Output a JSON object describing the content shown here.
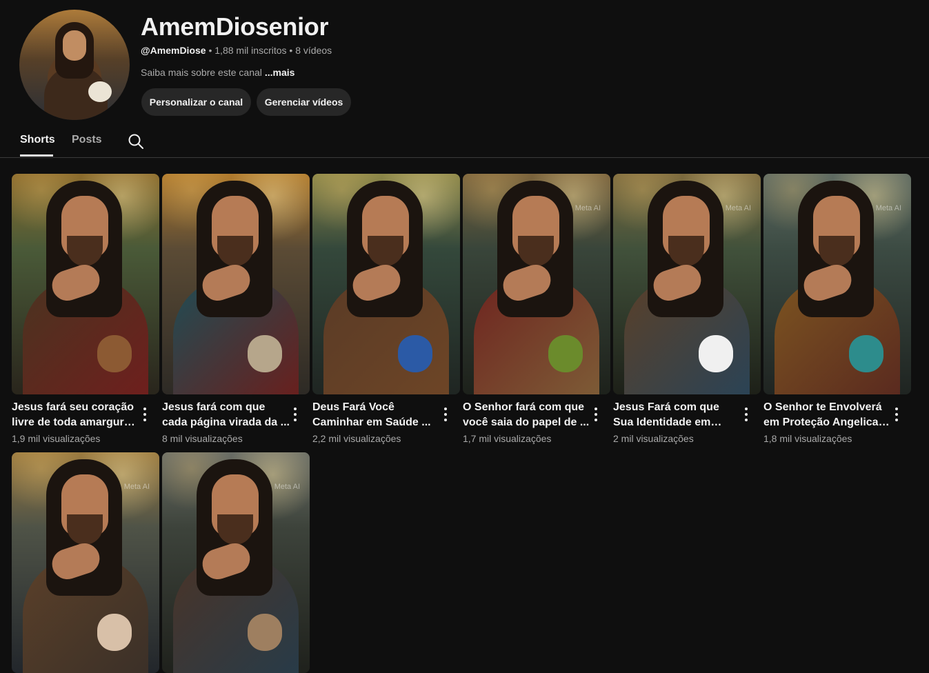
{
  "channel": {
    "name": "AmemDiosenior",
    "handle": "@AmemDiose",
    "subscribers": "1,88 mil inscritos",
    "videos_count": "8 vídeos",
    "about": "Saiba mais sobre este canal",
    "more_label": "...mais"
  },
  "buttons": {
    "customize": "Personalizar o canal",
    "manage": "Gerenciar vídeos"
  },
  "tabs": [
    {
      "label": "Shorts"
    },
    {
      "label": "Posts"
    }
  ],
  "cards": [
    {
      "title": "Jesus fará seu coração livre de toda amargura ...",
      "views": "1,9 mil visualizações",
      "colors": {
        "sky1": "#8c6b2c",
        "sky2": "#4a5a38",
        "ground": "#29251c",
        "robe1": "#4a3420",
        "robe2": "#6e1f1d",
        "animal": "#8c5a33"
      }
    },
    {
      "title": "Jesus fará com que cada página virada da ...",
      "views": "8 mil visualizações",
      "colors": {
        "sky1": "#b17b2d",
        "sky2": "#5b4b35",
        "ground": "#2d2a25",
        "robe1": "#1f4d55",
        "robe2": "#68201e",
        "animal": "#b6a68b"
      }
    },
    {
      "title": "Deus Fará Você Caminhar em Saúde ...",
      "views": "2,2 mil visualizações",
      "colors": {
        "sky1": "#8d8748",
        "sky2": "#34483b",
        "ground": "#1f2522",
        "robe1": "#5a3b26",
        "robe2": "#6d4526",
        "animal": "#2b5aa6"
      }
    },
    {
      "title": "O Senhor fará com que você saia do papel de ...",
      "views": "1,7 mil visualizações",
      "colors": {
        "sky1": "#7b633c",
        "sky2": "#39453a",
        "ground": "#1d211b",
        "robe1": "#6e241f",
        "robe2": "#7d5b36",
        "animal": "#6b8b2c"
      }
    },
    {
      "title": "Jesus Fará com que Sua Identidade em Cristo ...",
      "views": "2 mil visualizações",
      "colors": {
        "sky1": "#7e6b3e",
        "sky2": "#41513b",
        "ground": "#1d2018",
        "robe1": "#5a4029",
        "robe2": "#2b4355",
        "animal": "#f0f0f0"
      }
    },
    {
      "title": "O Senhor te Envolverá em Proteção Angelical ...",
      "views": "1,8 mil visualizações",
      "colors": {
        "sky1": "#5e6a62",
        "sky2": "#3c4b43",
        "ground": "#1f2421",
        "robe1": "#7c5420",
        "robe2": "#5a2a1f",
        "animal": "#2d8c8c"
      }
    },
    {
      "title": "",
      "views": "",
      "colors": {
        "sky1": "#9b7a3f",
        "sky2": "#4f5347",
        "ground": "#22262b",
        "robe1": "#5b4029",
        "robe2": "#3b3028",
        "animal": "#d8c0a8"
      }
    },
    {
      "title": "",
      "views": "",
      "colors": {
        "sky1": "#6a6d66",
        "sky2": "#3d433b",
        "ground": "#1f211c",
        "robe1": "#4a3428",
        "robe2": "#283b48",
        "animal": "#9e7f60"
      }
    }
  ],
  "watermark": "Meta AI"
}
